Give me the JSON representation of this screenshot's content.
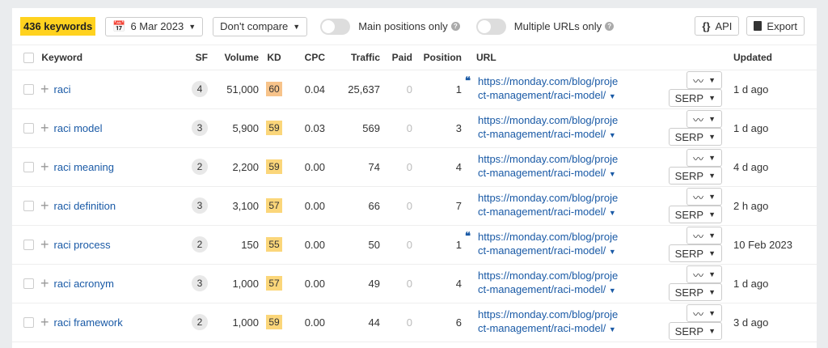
{
  "toolbar": {
    "keyword_count": "436 keywords",
    "date": "6 Mar 2023",
    "compare": "Don't compare",
    "main_positions": "Main positions only",
    "multiple_urls": "Multiple URLs only",
    "api": "API",
    "export": "Export"
  },
  "headers": {
    "keyword": "Keyword",
    "sf": "SF",
    "volume": "Volume",
    "kd": "KD",
    "cpc": "CPC",
    "traffic": "Traffic",
    "paid": "Paid",
    "position": "Position",
    "url": "URL",
    "updated": "Updated"
  },
  "serp_label": "SERP",
  "rows": [
    {
      "keyword": "raci",
      "sf": "4",
      "volume": "51,000",
      "kd": "60",
      "kd_color": "#f7c38a",
      "cpc": "0.04",
      "traffic": "25,637",
      "paid": "0",
      "position": "1",
      "quote": true,
      "url1": "https://monday.com/blog/proje",
      "url2": "ct-management/raci-model/",
      "updated": "1 d ago"
    },
    {
      "keyword": "raci model",
      "sf": "3",
      "volume": "5,900",
      "kd": "59",
      "kd_color": "#fbd67a",
      "cpc": "0.03",
      "traffic": "569",
      "paid": "0",
      "position": "3",
      "quote": false,
      "url1": "https://monday.com/blog/proje",
      "url2": "ct-management/raci-model/",
      "updated": "1 d ago"
    },
    {
      "keyword": "raci meaning",
      "sf": "2",
      "volume": "2,200",
      "kd": "59",
      "kd_color": "#fbd67a",
      "cpc": "0.00",
      "traffic": "74",
      "paid": "0",
      "position": "4",
      "quote": false,
      "url1": "https://monday.com/blog/proje",
      "url2": "ct-management/raci-model/",
      "updated": "4 d ago"
    },
    {
      "keyword": "raci definition",
      "sf": "3",
      "volume": "3,100",
      "kd": "57",
      "kd_color": "#fbd67a",
      "cpc": "0.00",
      "traffic": "66",
      "paid": "0",
      "position": "7",
      "quote": false,
      "url1": "https://monday.com/blog/proje",
      "url2": "ct-management/raci-model/",
      "updated": "2 h ago"
    },
    {
      "keyword": "raci process",
      "sf": "2",
      "volume": "150",
      "kd": "55",
      "kd_color": "#fbd67a",
      "cpc": "0.00",
      "traffic": "50",
      "paid": "0",
      "position": "1",
      "quote": true,
      "url1": "https://monday.com/blog/proje",
      "url2": "ct-management/raci-model/",
      "updated": "10 Feb 2023"
    },
    {
      "keyword": "raci acronym",
      "sf": "3",
      "volume": "1,000",
      "kd": "57",
      "kd_color": "#fbd67a",
      "cpc": "0.00",
      "traffic": "49",
      "paid": "0",
      "position": "4",
      "quote": false,
      "url1": "https://monday.com/blog/proje",
      "url2": "ct-management/raci-model/",
      "updated": "1 d ago"
    },
    {
      "keyword": "raci framework",
      "sf": "2",
      "volume": "1,000",
      "kd": "59",
      "kd_color": "#fbd67a",
      "cpc": "0.00",
      "traffic": "44",
      "paid": "0",
      "position": "6",
      "quote": false,
      "url1": "https://monday.com/blog/proje",
      "url2": "ct-management/raci-model/",
      "updated": "3 d ago"
    }
  ]
}
